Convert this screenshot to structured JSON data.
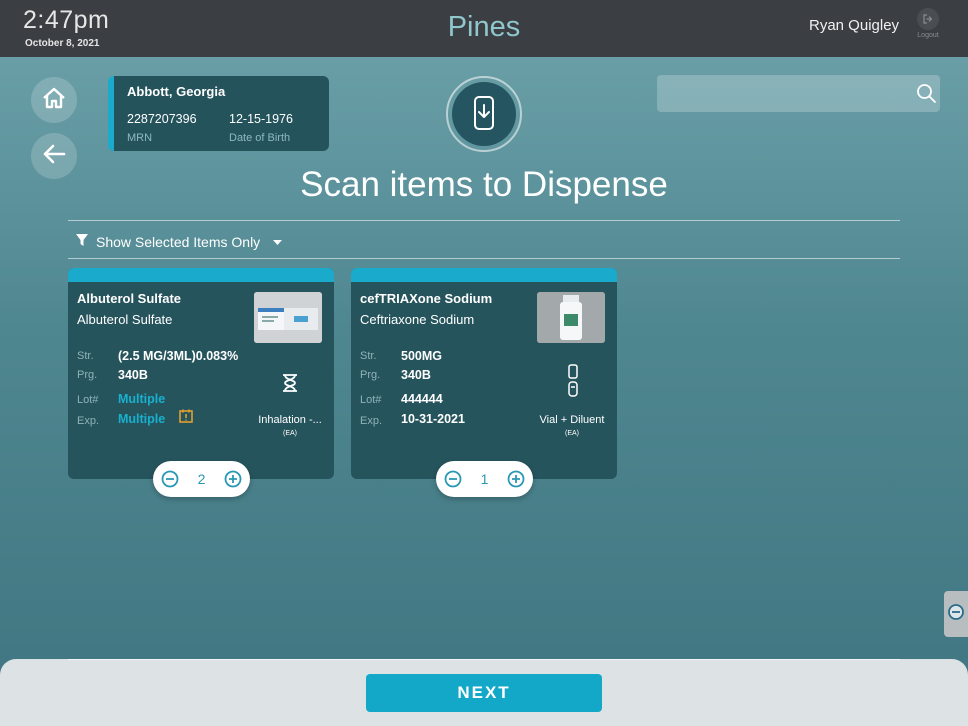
{
  "header": {
    "time": "2:47pm",
    "date": "October 8, 2021",
    "brand": "Pines",
    "user": "Ryan Quigley",
    "logout_label": "Logout"
  },
  "nav": {
    "home_icon": "home-icon",
    "back_icon": "arrow-left-icon"
  },
  "patient": {
    "name": "Abbott, Georgia",
    "mrn": "2287207396",
    "mrn_label": "MRN",
    "dob": "12-15-1976",
    "dob_label": "Date of Birth"
  },
  "scan_icon": "scan-device-icon",
  "search": {
    "placeholder": "",
    "icon": "search-icon"
  },
  "page_title": "Scan items to Dispense",
  "filter": {
    "label": "Show Selected Items Only",
    "icon": "filter-icon"
  },
  "labels": {
    "strength": "Str.",
    "program": "Prg.",
    "lot": "Lot#",
    "expiration": "Exp."
  },
  "items": [
    {
      "name": "Albuterol Sulfate",
      "generic": "Albuterol Sulfate",
      "strength": "(2.5 MG/3ML)0.083%",
      "program": "340B",
      "lot": "Multiple",
      "expiration": "Multiple",
      "form": "Inhalation -...",
      "unit": "(EA)",
      "form_icon": "hourglass-icon",
      "quantity": "2"
    },
    {
      "name": "cefTRIAXone Sodium",
      "generic": "Ceftriaxone Sodium",
      "strength": "500MG",
      "program": "340B",
      "lot": "444444",
      "expiration": "10-31-2021",
      "form": "Vial + Diluent",
      "unit": "(EA)",
      "form_icon": "vial-icon",
      "quantity": "1"
    }
  ],
  "colors": {
    "accent": "#1aaacb",
    "card": "#26545d",
    "topbar": "#3b3e42",
    "warning": "#e0a030"
  },
  "footer": {
    "next_label": "NEXT"
  }
}
